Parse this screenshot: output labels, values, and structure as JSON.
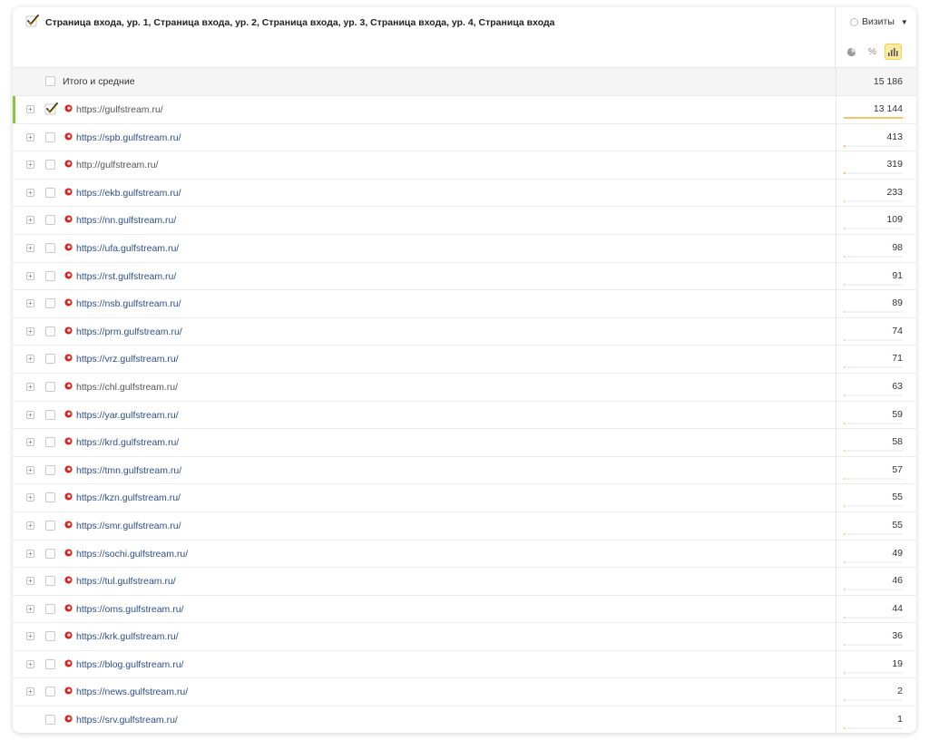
{
  "header": {
    "dimensions_title": "Страница входа, ур. 1, Страница входа, ур. 2, Страница входа, ур. 3, Страница входа, ур. 4, Страница входа",
    "metric_label": "Визиты",
    "view_modes": [
      {
        "icon": "pie-chart-icon",
        "label": ""
      },
      {
        "icon": "percent-icon",
        "label": "%"
      },
      {
        "icon": "bar-chart-icon",
        "label": ""
      }
    ],
    "active_view": "bar-chart-icon"
  },
  "total": {
    "label": "Итого и средние",
    "value": "15 186"
  },
  "colors": {
    "accent_bar": "#f6c46a",
    "selected_marker": "#8cc63f",
    "link": "#2d4e8c",
    "favicon": "#d6241e"
  },
  "rows": [
    {
      "url": "https://gulfstream.ru/",
      "value": "13 144",
      "visits": 13144,
      "checked": true,
      "selected": true,
      "expandable": true,
      "link_style": "gray"
    },
    {
      "url": "https://spb.gulfstream.ru/",
      "value": "413",
      "visits": 413,
      "checked": false,
      "selected": false,
      "expandable": true,
      "link_style": "link"
    },
    {
      "url": "http://gulfstream.ru/",
      "value": "319",
      "visits": 319,
      "checked": false,
      "selected": false,
      "expandable": true,
      "link_style": "gray"
    },
    {
      "url": "https://ekb.gulfstream.ru/",
      "value": "233",
      "visits": 233,
      "checked": false,
      "selected": false,
      "expandable": true,
      "link_style": "link"
    },
    {
      "url": "https://nn.gulfstream.ru/",
      "value": "109",
      "visits": 109,
      "checked": false,
      "selected": false,
      "expandable": true,
      "link_style": "link"
    },
    {
      "url": "https://ufa.gulfstream.ru/",
      "value": "98",
      "visits": 98,
      "checked": false,
      "selected": false,
      "expandable": true,
      "link_style": "link"
    },
    {
      "url": "https://rst.gulfstream.ru/",
      "value": "91",
      "visits": 91,
      "checked": false,
      "selected": false,
      "expandable": true,
      "link_style": "link"
    },
    {
      "url": "https://nsb.gulfstream.ru/",
      "value": "89",
      "visits": 89,
      "checked": false,
      "selected": false,
      "expandable": true,
      "link_style": "link"
    },
    {
      "url": "https://prm.gulfstream.ru/",
      "value": "74",
      "visits": 74,
      "checked": false,
      "selected": false,
      "expandable": true,
      "link_style": "link"
    },
    {
      "url": "https://vrz.gulfstream.ru/",
      "value": "71",
      "visits": 71,
      "checked": false,
      "selected": false,
      "expandable": true,
      "link_style": "link"
    },
    {
      "url": "https://chl.gulfstream.ru/",
      "value": "63",
      "visits": 63,
      "checked": false,
      "selected": false,
      "expandable": true,
      "link_style": "gray"
    },
    {
      "url": "https://yar.gulfstream.ru/",
      "value": "59",
      "visits": 59,
      "checked": false,
      "selected": false,
      "expandable": true,
      "link_style": "link"
    },
    {
      "url": "https://krd.gulfstream.ru/",
      "value": "58",
      "visits": 58,
      "checked": false,
      "selected": false,
      "expandable": true,
      "link_style": "link"
    },
    {
      "url": "https://tmn.gulfstream.ru/",
      "value": "57",
      "visits": 57,
      "checked": false,
      "selected": false,
      "expandable": true,
      "link_style": "link"
    },
    {
      "url": "https://kzn.gulfstream.ru/",
      "value": "55",
      "visits": 55,
      "checked": false,
      "selected": false,
      "expandable": true,
      "link_style": "link"
    },
    {
      "url": "https://smr.gulfstream.ru/",
      "value": "55",
      "visits": 55,
      "checked": false,
      "selected": false,
      "expandable": true,
      "link_style": "link"
    },
    {
      "url": "https://sochi.gulfstream.ru/",
      "value": "49",
      "visits": 49,
      "checked": false,
      "selected": false,
      "expandable": true,
      "link_style": "link"
    },
    {
      "url": "https://tul.gulfstream.ru/",
      "value": "46",
      "visits": 46,
      "checked": false,
      "selected": false,
      "expandable": true,
      "link_style": "link"
    },
    {
      "url": "https://oms.gulfstream.ru/",
      "value": "44",
      "visits": 44,
      "checked": false,
      "selected": false,
      "expandable": true,
      "link_style": "link"
    },
    {
      "url": "https://krk.gulfstream.ru/",
      "value": "36",
      "visits": 36,
      "checked": false,
      "selected": false,
      "expandable": true,
      "link_style": "link"
    },
    {
      "url": "https://blog.gulfstream.ru/",
      "value": "19",
      "visits": 19,
      "checked": false,
      "selected": false,
      "expandable": true,
      "link_style": "link"
    },
    {
      "url": "https://news.gulfstream.ru/",
      "value": "2",
      "visits": 2,
      "checked": false,
      "selected": false,
      "expandable": true,
      "link_style": "link"
    },
    {
      "url": "https://srv.gulfstream.ru/",
      "value": "1",
      "visits": 1,
      "checked": false,
      "selected": false,
      "expandable": false,
      "link_style": "link"
    }
  ]
}
